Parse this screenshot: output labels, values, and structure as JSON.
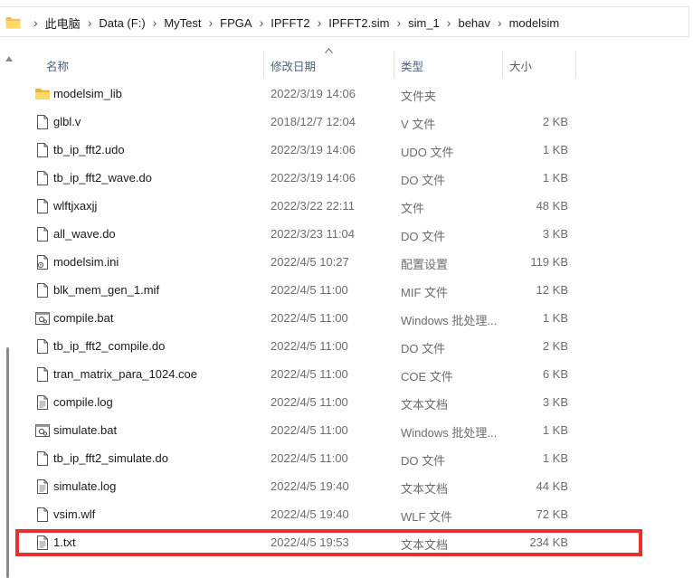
{
  "breadcrumbs": [
    "此电脑",
    "Data (F:)",
    "MyTest",
    "FPGA",
    "IPFFT2",
    "IPFFT2.sim",
    "sim_1",
    "behav",
    "modelsim"
  ],
  "columns": {
    "name": "名称",
    "date": "修改日期",
    "type": "类型",
    "size": "大小"
  },
  "sort": {
    "column": "date",
    "direction": "ascending"
  },
  "files": [
    {
      "name": "modelsim_lib",
      "date": "2022/3/19 14:06",
      "type": "文件夹",
      "size": "",
      "icon": "folder-icon"
    },
    {
      "name": "glbl.v",
      "date": "2018/12/7 12:04",
      "type": "V 文件",
      "size": "2 KB",
      "icon": "file-icon"
    },
    {
      "name": "tb_ip_fft2.udo",
      "date": "2022/3/19 14:06",
      "type": "UDO 文件",
      "size": "1 KB",
      "icon": "file-icon"
    },
    {
      "name": "tb_ip_fft2_wave.do",
      "date": "2022/3/19 14:06",
      "type": "DO 文件",
      "size": "1 KB",
      "icon": "file-icon"
    },
    {
      "name": "wlftjxaxjj",
      "date": "2022/3/22 22:11",
      "type": "文件",
      "size": "48 KB",
      "icon": "file-icon"
    },
    {
      "name": "all_wave.do",
      "date": "2022/3/23 11:04",
      "type": "DO 文件",
      "size": "3 KB",
      "icon": "file-icon"
    },
    {
      "name": "modelsim.ini",
      "date": "2022/4/5 10:27",
      "type": "配置设置",
      "size": "119 KB",
      "icon": "settings-file-icon"
    },
    {
      "name": "blk_mem_gen_1.mif",
      "date": "2022/4/5 11:00",
      "type": "MIF 文件",
      "size": "12 KB",
      "icon": "file-icon"
    },
    {
      "name": "compile.bat",
      "date": "2022/4/5 11:00",
      "type": "Windows 批处理...",
      "size": "1 KB",
      "icon": "batch-file-icon"
    },
    {
      "name": "tb_ip_fft2_compile.do",
      "date": "2022/4/5 11:00",
      "type": "DO 文件",
      "size": "2 KB",
      "icon": "file-icon"
    },
    {
      "name": "tran_matrix_para_1024.coe",
      "date": "2022/4/5 11:00",
      "type": "COE 文件",
      "size": "6 KB",
      "icon": "file-icon"
    },
    {
      "name": "compile.log",
      "date": "2022/4/5 11:00",
      "type": "文本文档",
      "size": "3 KB",
      "icon": "text-file-icon"
    },
    {
      "name": "simulate.bat",
      "date": "2022/4/5 11:00",
      "type": "Windows 批处理...",
      "size": "1 KB",
      "icon": "batch-file-icon"
    },
    {
      "name": "tb_ip_fft2_simulate.do",
      "date": "2022/4/5 11:00",
      "type": "DO 文件",
      "size": "1 KB",
      "icon": "file-icon"
    },
    {
      "name": "simulate.log",
      "date": "2022/4/5 19:40",
      "type": "文本文档",
      "size": "44 KB",
      "icon": "text-file-icon"
    },
    {
      "name": "vsim.wlf",
      "date": "2022/4/5 19:40",
      "type": "WLF 文件",
      "size": "72 KB",
      "icon": "file-icon"
    },
    {
      "name": "1.txt",
      "date": "2022/4/5 19:53",
      "type": "文本文档",
      "size": "234 KB",
      "icon": "text-file-icon"
    }
  ],
  "colors": {
    "highlight": "#e8302f",
    "folder": "#f4c24e",
    "header_text": "#4c607a"
  }
}
